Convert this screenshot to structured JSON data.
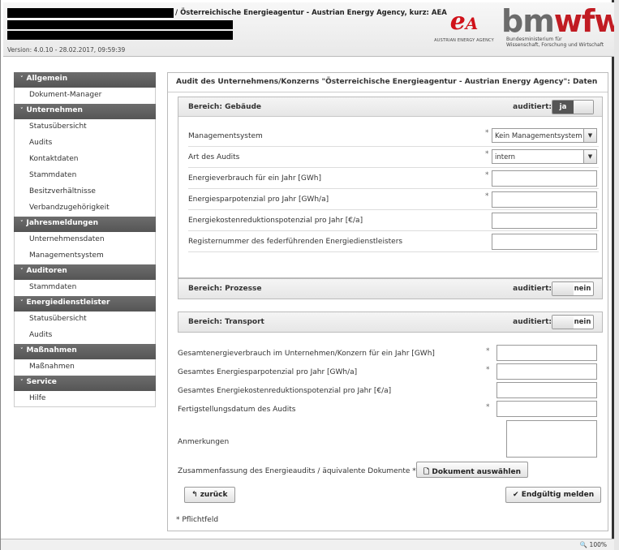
{
  "header": {
    "org_title": "/ Österreichische Energieagentur - Austrian Energy Agency, kurz: AEA",
    "version": "Version: 4.0.10 - 28.02.2017, 09:59:39",
    "ea_logo_caption": "AUSTRIAN ENERGY AGENCY",
    "bm_logo_word_a": "bm",
    "bm_logo_word_b": "wfw",
    "bm_logo_sub1": "Bundesministerium für",
    "bm_logo_sub2": "Wissenschaft, Forschung und Wirtschaft",
    "ea_logo_color": "#d0121a"
  },
  "sidebar": {
    "sections": [
      {
        "label": "Allgemein",
        "items": [
          "Dokument-Manager"
        ]
      },
      {
        "label": "Unternehmen",
        "items": [
          "Statusübersicht",
          "Audits",
          "Kontaktdaten",
          "Stammdaten",
          "Besitzverhältnisse",
          "Verbandzugehörigkeit"
        ]
      },
      {
        "label": "Jahresmeldungen",
        "items": [
          "Unternehmensdaten",
          "Managementsystem"
        ]
      },
      {
        "label": "Auditoren",
        "items": [
          "Stammdaten"
        ]
      },
      {
        "label": "Energiedienstleister",
        "items": [
          "Statusübersicht",
          "Audits"
        ]
      },
      {
        "label": "Maßnahmen",
        "items": [
          "Maßnahmen"
        ]
      },
      {
        "label": "Service",
        "items": [
          "Hilfe"
        ]
      }
    ]
  },
  "main": {
    "title": "Audit des Unternehmens/Konzerns \"Österreichische Energieagentur - Austrian Energy Agency\": Daten",
    "audited_label": "auditiert:",
    "section_gebaeude": {
      "title": "Bereich: Gebäude",
      "toggle_value": "ja",
      "fields": [
        {
          "label": "Managementsystem",
          "value": "Kein Managementsystem"
        },
        {
          "label": "Art des Audits",
          "value": "intern"
        },
        {
          "label": "Energieverbrauch für ein Jahr [GWh]",
          "value": ""
        },
        {
          "label": "Energiesparpotenzial pro Jahr [GWh/a]",
          "value": ""
        },
        {
          "label": "Energiekostenreduktionspotenzial pro Jahr [€/a]",
          "value": ""
        },
        {
          "label": "Registernummer des federführenden Energiedienstleisters",
          "value": ""
        }
      ]
    },
    "section_prozesse": {
      "title": "Bereich: Prozesse",
      "toggle_value": "nein"
    },
    "section_transport": {
      "title": "Bereich: Transport",
      "toggle_value": "nein"
    },
    "summary_fields": [
      {
        "label": "Gesamtenergieverbrauch im Unternehmen/Konzern für ein Jahr [GWh]",
        "value": ""
      },
      {
        "label": "Gesamtes Energiesparpotenzial pro Jahr [GWh/a]",
        "value": ""
      },
      {
        "label": "Gesamtes Energiekostenreduktionspotenzial pro Jahr [€/a]",
        "value": ""
      },
      {
        "label": "Fertigstellungsdatum des Audits",
        "value": ""
      }
    ],
    "remarks_label": "Anmerkungen",
    "summary_doc_label": "Zusammenfassung des Energieaudits / äquivalente Dokumente *",
    "doc_button": "Dokument auswählen",
    "back_button": "zurück",
    "submit_button": "Endgültig melden",
    "required_note": "* Pflichtfeld",
    "required_mark": "*"
  },
  "statusbar": {
    "zoom": "100%"
  }
}
